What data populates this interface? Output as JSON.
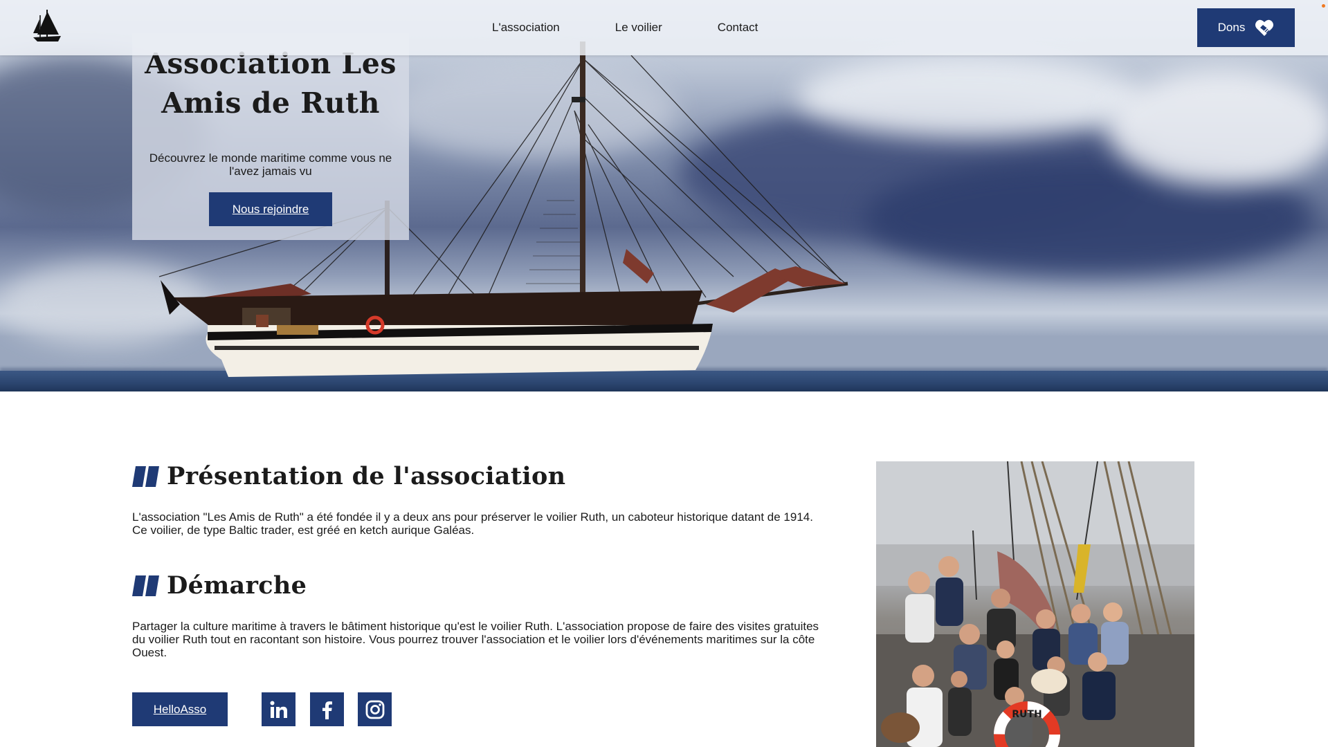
{
  "nav": {
    "logo_icon": "sailing-ship-logo-icon",
    "links": [
      "L'association",
      "Le voilier",
      "Contact"
    ],
    "donate_label": "Dons",
    "donate_icon": "handshake-heart-icon"
  },
  "hero": {
    "title_line1": "Association Les",
    "title_line2": "Amis de Ruth",
    "tagline": "Découvrez le monde maritime comme vous ne l'avez jamais vu",
    "cta_label": "Nous rejoindre"
  },
  "presentation": {
    "title": "Présentation de l'association",
    "text": "L'association \"Les Amis de Ruth\" a été fondée il y a deux ans pour préserver le voilier Ruth, un caboteur historique datant de 1914. Ce voilier, de type Baltic trader, est gréé en ketch aurique Galéas."
  },
  "demarche": {
    "title": "Démarche",
    "text": "Partager la culture maritime à travers le bâtiment historique qu'est le voilier Ruth. L'association propose de faire des visites gratuites du voilier Ruth tout en racontant son histoire. Vous pourrez trouver l'association et le voilier lors d'événements maritimes sur la côte Ouest."
  },
  "actions": {
    "helloasso_label": "HelloAsso",
    "social_icons": [
      "linkedin-icon",
      "facebook-icon",
      "instagram-icon"
    ]
  },
  "photo": {
    "lifebuoy_text": "RUTH"
  },
  "colors": {
    "primary": "#1f3a75",
    "text": "#1b1b1b",
    "accent_dot": "#f07a22"
  }
}
